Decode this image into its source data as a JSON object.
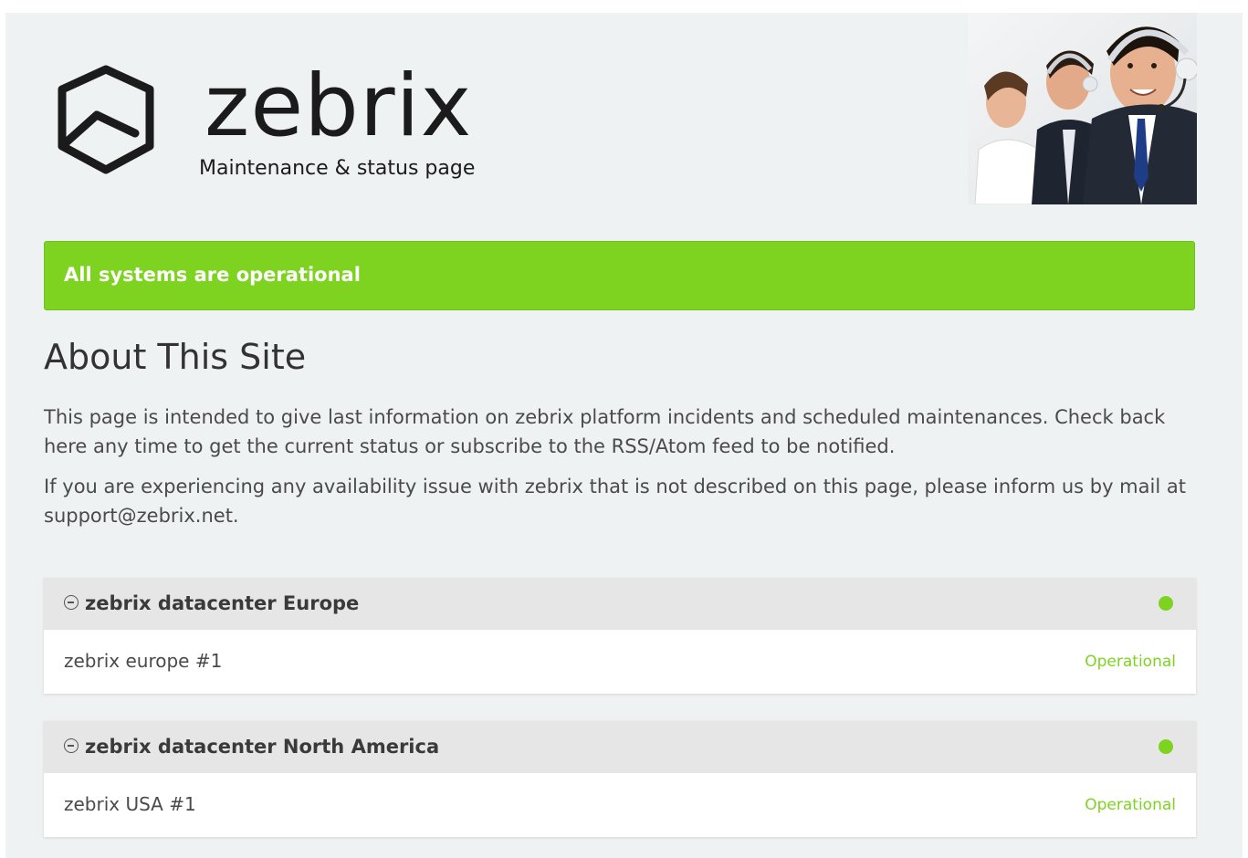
{
  "header": {
    "brand": "zebrix",
    "tagline": "Maintenance & status page"
  },
  "status_banner": {
    "text": "All systems are operational",
    "color": "#7ed321"
  },
  "about": {
    "title": "About This Site",
    "paragraph1": "This page is intended to give last information on zebrix platform incidents and scheduled maintenances. Check back here any time to get the current status or subscribe to the RSS/Atom feed to be notified.",
    "paragraph2": "If you are experiencing any availability issue with zebrix that is not described on this page, please inform us by mail at support@zebrix.net."
  },
  "groups": [
    {
      "name": "zebrix datacenter Europe",
      "toggle_icon": "collapse-circle-icon",
      "status_color": "#7ed321",
      "components": [
        {
          "name": "zebrix europe #1",
          "status": "Operational"
        }
      ]
    },
    {
      "name": "zebrix datacenter North America",
      "toggle_icon": "collapse-circle-icon",
      "status_color": "#7ed321",
      "components": [
        {
          "name": "zebrix USA #1",
          "status": "Operational"
        }
      ]
    }
  ],
  "colors": {
    "background": "#eff2f3",
    "operational": "#7ed321",
    "group_header": "#e6e6e6"
  }
}
